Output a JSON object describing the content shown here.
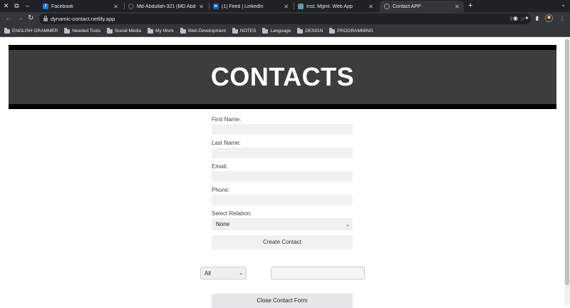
{
  "browser": {
    "tabs": [
      {
        "title": "Facebook",
        "favicon_color": "#1877f2",
        "favicon_glyph": "f",
        "active": false
      },
      {
        "title": "Md-Abdullah-321 (MD Abdullah",
        "favicon_color": "#24292e",
        "favicon_glyph": "",
        "active": false
      },
      {
        "title": "(1) Feed | LinkedIn",
        "favicon_color": "#0a66c2",
        "favicon_glyph": "in",
        "active": false
      },
      {
        "title": "Inst. Mgmt. Web App",
        "favicon_color": "#5f9ea0",
        "favicon_glyph": "",
        "active": false
      },
      {
        "title": "Contact APP",
        "favicon_color": "#9aa0a6",
        "favicon_glyph": "",
        "active": true
      }
    ],
    "new_tab_glyph": "+",
    "url": "dynamic-contact.netlify.app",
    "bookmarks": [
      "ENGLISH GRAMMER",
      "Needed Tools",
      "Social Media",
      "My Work",
      "Web Development",
      "NOTES",
      "Language",
      "DESIGN",
      "PROGRAMMING"
    ]
  },
  "header": {
    "title": "CONTACTS"
  },
  "form": {
    "first_name_label": "First Name:",
    "first_name_value": "",
    "last_name_label": "Last Name:",
    "last_name_value": "",
    "email_label": "Email:",
    "email_value": "",
    "phone_label": "Phone:",
    "phone_value": "",
    "relation_label": "Select Relation:",
    "relation_selected": "None",
    "create_button": "Create Contact"
  },
  "filter": {
    "selected": "All",
    "search_value": ""
  },
  "close_button": "Close Contact Form",
  "colors": {
    "header_bg": "#3d3d3d",
    "header_border": "#000000",
    "input_bg": "#f1f1f3"
  }
}
